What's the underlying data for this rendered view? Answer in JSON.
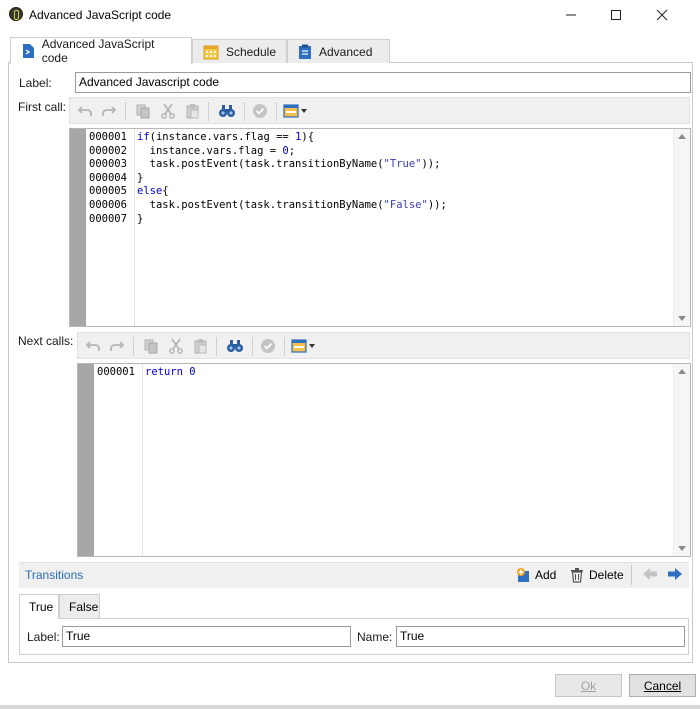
{
  "window": {
    "title": "Advanced JavaScript code",
    "controls": {
      "minimize": "minimize",
      "maximize": "maximize",
      "close": "close"
    }
  },
  "tabs": [
    {
      "label": "Advanced JavaScript code",
      "icon": "script-icon",
      "active": true
    },
    {
      "label": "Schedule",
      "icon": "calendar-icon",
      "active": false
    },
    {
      "label": "Advanced",
      "icon": "clipboard-icon",
      "active": false
    }
  ],
  "form": {
    "label_caption": "Label:",
    "label_value": "Advanced Javascript code",
    "first_call_caption": "First call:",
    "next_calls_caption": "Next calls:"
  },
  "toolbar_icons": [
    "undo-icon",
    "redo-icon",
    "copy-icon",
    "cut-icon",
    "paste-icon",
    "find-icon",
    "check-icon",
    "insert-field-icon"
  ],
  "first_call": {
    "line_numbers": [
      "000001",
      "000002",
      "000003",
      "000004",
      "000005",
      "000006",
      "000007"
    ],
    "code_lines": [
      "if(instance.vars.flag == 1){",
      "  instance.vars.flag = 0;",
      "  task.postEvent(task.transitionByName(\"True\"));",
      "}",
      "else{",
      "  task.postEvent(task.transitionByName(\"False\"));",
      "}"
    ]
  },
  "next_calls": {
    "line_numbers": [
      "000001"
    ],
    "code_lines": [
      "return 0"
    ]
  },
  "transitions": {
    "title": "Transitions",
    "add_label": "Add",
    "delete_label": "Delete",
    "tabs": [
      "True",
      "False"
    ],
    "active_tab": "True",
    "label_caption": "Label:",
    "label_value": "True",
    "name_caption": "Name:",
    "name_value": "True"
  },
  "buttons": {
    "ok": "Ok",
    "cancel": "Cancel"
  },
  "colors": {
    "accent": "#2a6cb5",
    "keyword": "#0000cc",
    "gutter": "#a7a7a7"
  }
}
